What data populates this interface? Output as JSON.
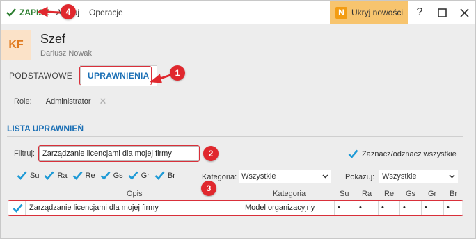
{
  "toolbar": {
    "save_label": "ZAPISZ",
    "cancel_label": "Anuluj",
    "operations_label": "Operacje",
    "news_badge": "N",
    "news_label": "Ukryj nowości",
    "help_symbol": "?",
    "save_icon": "check-icon",
    "maximize_icon": "maximize-icon",
    "close_icon": "close-icon"
  },
  "header": {
    "initials": "KF",
    "title": "Szef",
    "subtitle": "Dariusz Nowak"
  },
  "tabs": [
    {
      "label": "PODSTAWOWE",
      "active": false
    },
    {
      "label": "UPRAWNIENIA",
      "active": true
    }
  ],
  "role": {
    "label": "Role:",
    "value": "Administrator"
  },
  "section": {
    "title": "LISTA UPRAWNIEŃ"
  },
  "filter": {
    "label": "Filtruj:",
    "value": "Zarządzanie licencjami dla mojej firmy"
  },
  "select_all": {
    "label": "Zaznacz/odznacz wszystkie",
    "checked": true
  },
  "permission_flags": [
    {
      "label": "Su",
      "checked": true
    },
    {
      "label": "Ra",
      "checked": true
    },
    {
      "label": "Re",
      "checked": true
    },
    {
      "label": "Gs",
      "checked": true
    },
    {
      "label": "Gr",
      "checked": true
    },
    {
      "label": "Br",
      "checked": true
    }
  ],
  "category_filter": {
    "label": "Kategoria:",
    "value": "Wszystkie"
  },
  "show_filter": {
    "label": "Pokazuj:",
    "value": "Wszystkie"
  },
  "grid": {
    "columns": [
      "Opis",
      "Kategoria",
      "Su",
      "Ra",
      "Re",
      "Gs",
      "Gr",
      "Br"
    ],
    "rows": [
      {
        "checked": true,
        "description": "Zarządzanie licencjami dla mojej firmy",
        "category": "Model organizacyjny",
        "flags": [
          "•",
          "•",
          "•",
          "•",
          "•",
          "•"
        ]
      }
    ]
  },
  "annotations": [
    "1",
    "2",
    "3",
    "4"
  ],
  "colors": {
    "accent_blue": "#1a6fb5",
    "save_green": "#2a7d2e",
    "check_blue": "#1e9ad6",
    "news_bg": "#f7c46e",
    "news_badge_bg": "#f39c12",
    "annotation_red": "#d9303a",
    "avatar_bg": "#fbe2c8",
    "avatar_text": "#e07a1f"
  }
}
